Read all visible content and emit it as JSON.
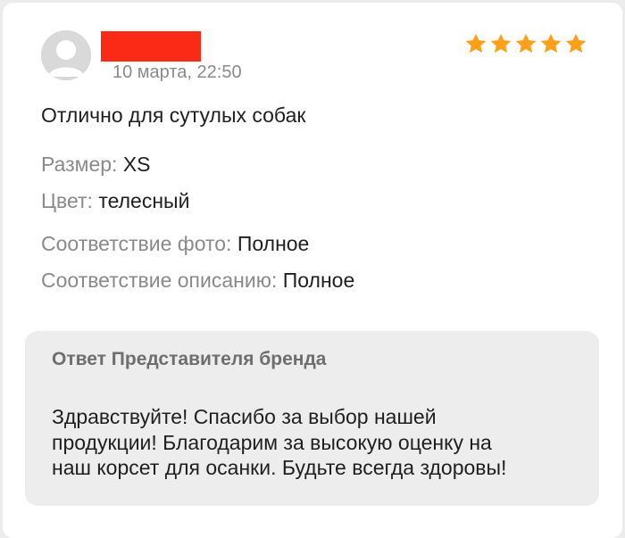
{
  "review": {
    "date": "10 марта, 22:50",
    "rating": 5,
    "rating_max": 5,
    "star_color": "#ff9f1a",
    "redaction_color": "#fb2a17",
    "text": "Отлично для сутулых собак",
    "attributes": {
      "size_label": "Размер:",
      "size_value": "XS",
      "color_label": "Цвет:",
      "color_value": "телесный",
      "photo_label": "Соответствие фото:",
      "photo_value": "Полное",
      "desc_label": "Соответствие описанию:",
      "desc_value": "Полное"
    }
  },
  "reply": {
    "title": "Ответ Представителя бренда",
    "lines": [
      "Здравствуйте! Спасибо за выбор нашей",
      "продукции! Благодарим за высокую оценку на",
      "наш корсет для осанки. Будьте всегда здоровы!"
    ]
  }
}
